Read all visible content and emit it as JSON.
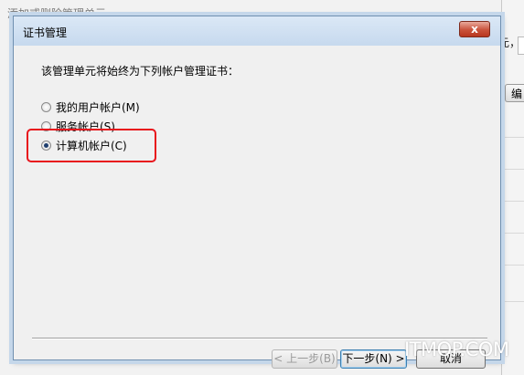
{
  "background": {
    "title": "添加或删除管理单元",
    "suffix_text": "元，",
    "edit_button": "编"
  },
  "dialog": {
    "title": "证书管理",
    "close_glyph": "x",
    "prompt": "该管理单元将始终为下列帐户管理证书：",
    "options": [
      {
        "label": "我的用户帐户(M)",
        "checked": false
      },
      {
        "label": "服务帐户(S)",
        "checked": false
      },
      {
        "label": "计算机帐户(C)",
        "checked": true
      }
    ],
    "buttons": {
      "back": "< 上一步(B)",
      "next": "下一步(N) >",
      "cancel": "取消"
    }
  },
  "watermark": "ITMOP.COM",
  "colors": {
    "highlight": "#e8141c",
    "close_button": "#c9523b",
    "titlebar": "#c6d9ee"
  }
}
